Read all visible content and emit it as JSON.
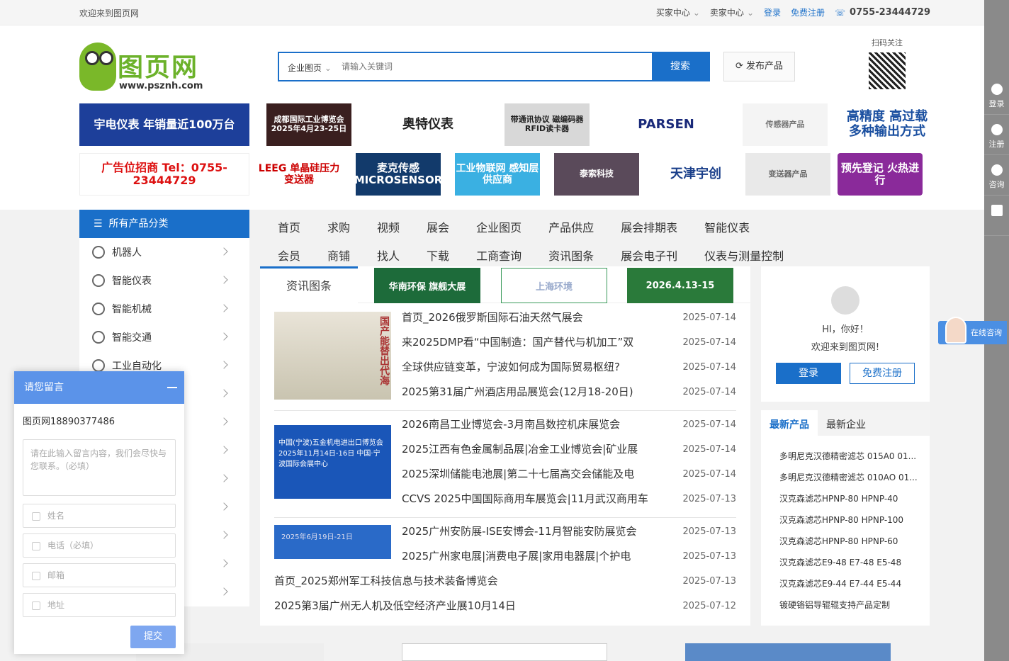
{
  "topbar": {
    "welcome": "欢迎来到图页网",
    "buyer": "买家中心",
    "seller": "卖家中心",
    "login": "登录",
    "register": "免费注册",
    "phone": "0755-23444729"
  },
  "logo": {
    "name": "图页网",
    "url": "www.psznh.com"
  },
  "search": {
    "category": "企业图页",
    "placeholder": "请输入关键词",
    "button": "搜索"
  },
  "publish": "发布产品",
  "qr": {
    "label": "扫码关注"
  },
  "ads_row1": [
    "宇电仪表 年销量近100万台",
    "成都国际工业博览会 2025年4月23-25日",
    "奥特仪表",
    "带通讯协议 磁编码器 RFID读卡器",
    "PARSEN",
    "传感器产品",
    "高精度 高过载 多种输出方式"
  ],
  "ads_row2": [
    "广告位招商 Tel：0755-23444729",
    "LEEG 单晶硅压力变送器",
    "麦克传感 MICROSENSOR",
    "工业物联网 感知层供应商",
    "泰索科技",
    "天津宇创",
    "变送器产品",
    "预先登记 火热进行"
  ],
  "category": {
    "title": "所有产品分类",
    "items": [
      "机器人",
      "智能仪表",
      "智能机械",
      "智能交通",
      "工业自动化",
      "",
      "",
      "",
      "",
      "",
      "",
      "",
      ""
    ]
  },
  "mainnav": {
    "row1": [
      "首页",
      "求购",
      "视频",
      "展会",
      "企业图页",
      "产品供应",
      "展会排期表",
      "智能仪表"
    ],
    "row2": [
      "会员",
      "商铺",
      "找人",
      "下载",
      "工商查询",
      "资讯图条",
      "展会电子刊",
      "仪表与测量控制"
    ]
  },
  "news": {
    "tab": "资讯图条",
    "banners": [
      "华南环保 旗舰大展",
      "上海环境",
      "2026.4.13-15"
    ],
    "group1": [
      {
        "title": "首页_2026俄罗斯国际石油天然气展会",
        "date": "2025-07-14"
      },
      {
        "title": "来2025DMP看“中国制造：国产替代与机加工”双",
        "date": "2025-07-14"
      },
      {
        "title": "全球供应链变革，宁波如何成为国际贸易枢纽?",
        "date": "2025-07-14"
      },
      {
        "title": "2025第31届广州酒店用品展览会(12月18-20日)",
        "date": "2025-07-14"
      }
    ],
    "group2": [
      {
        "title": "2026南昌工业博览会-3月南昌数控机床展览会",
        "date": "2025-07-14"
      },
      {
        "title": "2025江西有色金属制品展|冶金工业博览会|矿业展",
        "date": "2025-07-14"
      },
      {
        "title": "2025深圳储能电池展|第二十七届高交会储能及电",
        "date": "2025-07-14"
      },
      {
        "title": "CCVS 2025中国国际商用车展览会|11月武汉商用车",
        "date": "2025-07-13"
      }
    ],
    "group3": [
      {
        "title": "2025广州安防展-ISE安博会-11月智能安防展览会",
        "date": "2025-07-13"
      },
      {
        "title": "2025广州家电展|消费电子展|家用电器展|个护电",
        "date": "2025-07-13"
      },
      {
        "title": "首页_2025郑州军工科技信息与技术装备博览会",
        "date": "2025-07-13"
      },
      {
        "title": "2025第3届广州无人机及低空经济产业展10月14日",
        "date": "2025-07-12"
      }
    ],
    "img1_text": "国产能替出代海",
    "img2_text": "中国(宁波)五金机电进出口博览会 2025年11月14日-16日 中国·宁波国际会展中心",
    "img3_text": "2025年6月19日-21日"
  },
  "userbox": {
    "greeting": "HI，你好！",
    "welcome": "欢迎来到图页网!",
    "login": "登录",
    "register": "免费注册"
  },
  "products": {
    "tab_active": "最新产品",
    "tab2": "最新企业",
    "items": [
      "多明尼克汉德精密滤芯 015A0 01...",
      "多明尼克汉德精密滤芯 010AO 01...",
      "汉克森滤芯HPNP-80 HPNP-40",
      "汉克森滤芯HPNP-80 HPNP-100",
      "汉克森滤芯HPNP-80 HPNP-60",
      "汉克森滤芯E9-48 E7-48 E5-48",
      "汉克森滤芯E9-44 E7-44 E5-44",
      "镀硬铬铝导辊辊支持产品定制"
    ]
  },
  "sidebar": [
    "登录",
    "注册",
    "咨询",
    ""
  ],
  "consult": "在线咨询",
  "message": {
    "title": "请您留言",
    "phone": "图页网18890377486",
    "content_placeholder": "请在此输入留言内容，我们会尽快与您联系。（必填）",
    "name": "姓名",
    "tel": "电话（必填）",
    "email": "邮箱",
    "address": "地址",
    "submit": "提交"
  },
  "colors": {
    "accent": "#1a6fc9",
    "msg_header": "#5b93e9",
    "logo_green": "#6cb22b"
  }
}
